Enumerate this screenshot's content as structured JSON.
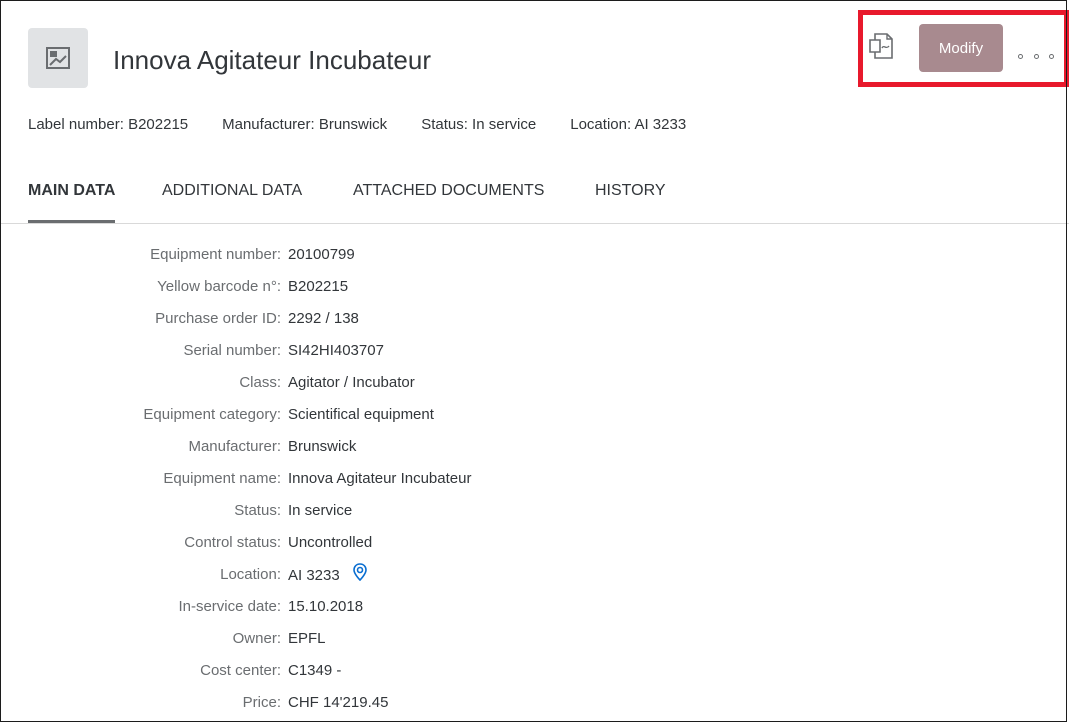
{
  "header": {
    "title": "Innova Agitateur Incubateur",
    "object_icon": "image-placeholder-icon",
    "attributes": [
      {
        "text": "Label number: B202215"
      },
      {
        "text": "Manufacturer: Brunswick"
      },
      {
        "text": "Status: In service"
      },
      {
        "text": "Location: AI 3233"
      }
    ],
    "actions": {
      "pdf_icon": "pdf-document-icon",
      "modify_label": "Modify",
      "more_icon": "overflow-dots-icon"
    },
    "highlight_color": "#e8192c",
    "modify_color": "#a88a8f"
  },
  "tabs": [
    {
      "label": "MAIN DATA",
      "active": true
    },
    {
      "label": "ADDITIONAL DATA",
      "active": false
    },
    {
      "label": "ATTACHED DOCUMENTS",
      "active": false
    },
    {
      "label": "HISTORY",
      "active": false
    }
  ],
  "main_data": {
    "fields": [
      {
        "label": "Equipment number:",
        "value": "20100799"
      },
      {
        "label": "Yellow barcode n°:",
        "value": "B202215"
      },
      {
        "label": "Purchase order ID:",
        "value": "2292 / 138"
      },
      {
        "label": "Serial number:",
        "value": "SI42HI403707"
      },
      {
        "label": "Class:",
        "value": "Agitator / Incubator"
      },
      {
        "label": "Equipment category:",
        "value": "Scientifical equipment"
      },
      {
        "label": "Manufacturer:",
        "value": "Brunswick"
      },
      {
        "label": "Equipment name:",
        "value": "Innova Agitateur Incubateur"
      },
      {
        "label": "Status:",
        "value": "In service"
      },
      {
        "label": "Control status:",
        "value": "Uncontrolled"
      },
      {
        "label": "Location:",
        "value": "AI 3233"
      },
      {
        "label": "In-service date:",
        "value": "15.10.2018"
      },
      {
        "label": "Owner:",
        "value": "EPFL"
      },
      {
        "label": "Cost center:",
        "value": "C1349 -"
      },
      {
        "label": "Price:",
        "value": "CHF 14'219.45"
      }
    ],
    "location_icon": "map-pin-icon",
    "location_icon_color": "#0a6ed1"
  }
}
